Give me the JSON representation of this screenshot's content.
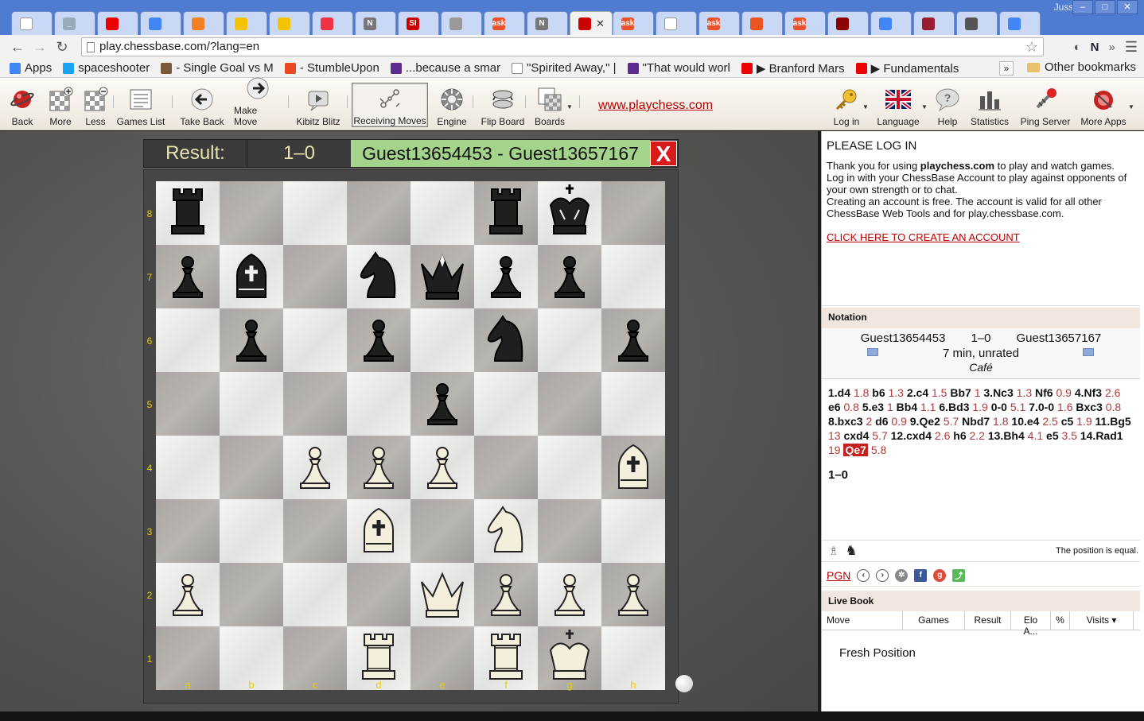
{
  "browser": {
    "user": "Jussi",
    "url": "play.chessbase.com/?lang=en",
    "tabs": [
      {
        "label": "",
        "fav": "doc-icon",
        "color": "#ffffff"
      },
      {
        "label": "_",
        "fav": "blank-icon",
        "color": "#9ab"
      },
      {
        "label": "",
        "fav": "youtube-icon",
        "color": "#e00"
      },
      {
        "label": "",
        "fav": "google-icon",
        "color": "#4285f4"
      },
      {
        "label": "",
        "fav": "stack-icon",
        "color": "#f48024"
      },
      {
        "label": "",
        "fav": "p-icon",
        "color": "#f5c400"
      },
      {
        "label": "",
        "fav": "p-icon",
        "color": "#f5c400"
      },
      {
        "label": "",
        "fav": "circle-icon",
        "color": "#e34"
      },
      {
        "label": "N",
        "fav": "n-icon",
        "color": "#777"
      },
      {
        "label": "SI",
        "fav": "si-icon",
        "color": "#c00"
      },
      {
        "label": "",
        "fav": "wand-icon",
        "color": "#999"
      },
      {
        "label": "ask",
        "fav": "ask-icon",
        "color": "#e8522c"
      },
      {
        "label": "N",
        "fav": "n-icon",
        "color": "#777"
      },
      {
        "label": "",
        "fav": "chessbase-icon",
        "color": "#c00",
        "active": true
      },
      {
        "label": "ask",
        "fav": "ask-icon",
        "color": "#e8522c"
      },
      {
        "label": "",
        "fav": "doc-icon",
        "color": "#ffffff"
      },
      {
        "label": "ask",
        "fav": "ask-icon",
        "color": "#e8522c"
      },
      {
        "label": "",
        "fav": "ubuntu-icon",
        "color": "#e95420"
      },
      {
        "label": "ask",
        "fav": "ask-icon",
        "color": "#e8522c"
      },
      {
        "label": "",
        "fav": "c-icon",
        "color": "#8b0000"
      },
      {
        "label": "",
        "fav": "google-icon",
        "color": "#4285f4"
      },
      {
        "label": "",
        "fav": "dice-icon",
        "color": "#9b1b30"
      },
      {
        "label": "",
        "fav": "u-icon",
        "color": "#555"
      },
      {
        "label": "",
        "fav": "google-icon",
        "color": "#4285f4"
      }
    ],
    "bookmarks": [
      {
        "label": "Apps",
        "color": "#4285f4"
      },
      {
        "label": "spaceshooter",
        "color": "#1da1f2"
      },
      {
        "label": "- Single Goal vs M",
        "color": "#7a5a3a"
      },
      {
        "label": "- StumbleUpon",
        "color": "#eb4924"
      },
      {
        "label": "...because a smar",
        "color": "#5b2d8e"
      },
      {
        "label": "\"Spirited Away,\" |",
        "color": "#ffffff"
      },
      {
        "label": "\"That would worl",
        "color": "#5b2d8e"
      },
      {
        "label": "▶ Branford Mars",
        "color": "#e00"
      },
      {
        "label": "▶ Fundamentals",
        "color": "#e00"
      }
    ],
    "bookmarks_overflow": "»",
    "other_bookmarks": "Other bookmarks"
  },
  "app_toolbar": {
    "buttons": [
      {
        "label": "Back",
        "icon": "planet-icon"
      },
      {
        "label": "More",
        "icon": "board-plus-icon"
      },
      {
        "label": "Less",
        "icon": "board-minus-icon"
      },
      {
        "label": "Games List",
        "icon": "list-icon"
      },
      {
        "label": "Take Back",
        "icon": "arrow-left-icon"
      },
      {
        "label": "Make Move",
        "icon": "arrow-right-icon"
      },
      {
        "label": "Kibitz Blitz",
        "icon": "kibitz-icon"
      },
      {
        "label": "Receiving Moves",
        "icon": "connection-icon",
        "pressed": true
      },
      {
        "label": "Engine",
        "icon": "engine-icon"
      },
      {
        "label": "Flip Board",
        "icon": "flip-icon"
      },
      {
        "label": "Boards",
        "icon": "boards-icon"
      }
    ],
    "link": "www.playchess.com",
    "right_buttons": [
      {
        "label": "Log in",
        "icon": "key-icon"
      },
      {
        "label": "Language",
        "icon": "uk-flag-icon"
      },
      {
        "label": "Help",
        "icon": "help-icon"
      },
      {
        "label": "Statistics",
        "icon": "statistics-icon"
      },
      {
        "label": "Ping Server",
        "icon": "ping-icon"
      },
      {
        "label": "More Apps",
        "icon": "apps-icon"
      }
    ]
  },
  "result_bar": {
    "label": "Result:",
    "score": "1–0",
    "players": "Guest13654453 - Guest13657167",
    "close": "X"
  },
  "board": {
    "ranks": [
      "8",
      "7",
      "6",
      "5",
      "4",
      "3",
      "2",
      "1"
    ],
    "files": [
      "a",
      "b",
      "c",
      "d",
      "e",
      "f",
      "g",
      "h"
    ],
    "pieces": [
      {
        "sq": "a8",
        "type": "r",
        "color": "b"
      },
      {
        "sq": "f8",
        "type": "r",
        "color": "b"
      },
      {
        "sq": "g8",
        "type": "k",
        "color": "b"
      },
      {
        "sq": "a7",
        "type": "p",
        "color": "b"
      },
      {
        "sq": "b7",
        "type": "b",
        "color": "b"
      },
      {
        "sq": "d7",
        "type": "n",
        "color": "b"
      },
      {
        "sq": "e7",
        "type": "q",
        "color": "b"
      },
      {
        "sq": "f7",
        "type": "p",
        "color": "b"
      },
      {
        "sq": "g7",
        "type": "p",
        "color": "b"
      },
      {
        "sq": "b6",
        "type": "p",
        "color": "b"
      },
      {
        "sq": "d6",
        "type": "p",
        "color": "b"
      },
      {
        "sq": "f6",
        "type": "n",
        "color": "b"
      },
      {
        "sq": "h6",
        "type": "p",
        "color": "b"
      },
      {
        "sq": "e5",
        "type": "p",
        "color": "b"
      },
      {
        "sq": "c4",
        "type": "p",
        "color": "w"
      },
      {
        "sq": "d4",
        "type": "p",
        "color": "w"
      },
      {
        "sq": "e4",
        "type": "p",
        "color": "w"
      },
      {
        "sq": "h4",
        "type": "b",
        "color": "w"
      },
      {
        "sq": "d3",
        "type": "b",
        "color": "w"
      },
      {
        "sq": "f3",
        "type": "n",
        "color": "w"
      },
      {
        "sq": "a2",
        "type": "p",
        "color": "w"
      },
      {
        "sq": "e2",
        "type": "q",
        "color": "w"
      },
      {
        "sq": "f2",
        "type": "p",
        "color": "w"
      },
      {
        "sq": "g2",
        "type": "p",
        "color": "w"
      },
      {
        "sq": "h2",
        "type": "p",
        "color": "w"
      },
      {
        "sq": "d1",
        "type": "r",
        "color": "w"
      },
      {
        "sq": "f1",
        "type": "r",
        "color": "w"
      },
      {
        "sq": "g1",
        "type": "k",
        "color": "w"
      }
    ]
  },
  "login": {
    "title": "PLEASE LOG IN",
    "line1_pre": "Thank you for using ",
    "line1_bold": "playchess.com",
    "line1_post": " to play and watch games.",
    "line2": "Log in with your ChessBase Account to play against opponents of your own strength or to chat.",
    "line3": "Creating an account is free. The account is valid for all other ChessBase Web Tools and for play.chessbase.com.",
    "create_link": "CLICK HERE TO CREATE AN ACCOUNT"
  },
  "notation": {
    "header": "Notation",
    "white": "Guest13654453",
    "result": "1–0",
    "black": "Guest13657167",
    "time_control": "7 min, unrated",
    "event": "Café",
    "moves": [
      {
        "m": "1.d4",
        "t": "1.8"
      },
      {
        "m": "b6",
        "t": "1.3"
      },
      {
        "m": "2.c4",
        "t": "1.5"
      },
      {
        "m": "Bb7",
        "t": "1"
      },
      {
        "m": "3.Nc3",
        "t": "1.3"
      },
      {
        "m": "Nf6",
        "t": "0.9"
      },
      {
        "m": "4.Nf3",
        "t": "2.6"
      },
      {
        "m": "e6",
        "t": "0.8"
      },
      {
        "m": "5.e3",
        "t": "1"
      },
      {
        "m": "Bb4",
        "t": "1.1"
      },
      {
        "m": "6.Bd3",
        "t": "1.9"
      },
      {
        "m": "0-0",
        "t": "5.1"
      },
      {
        "m": "7.0-0",
        "t": "1.6"
      },
      {
        "m": "Bxc3",
        "t": "0.8"
      },
      {
        "m": "8.bxc3",
        "t": "2"
      },
      {
        "m": "d6",
        "t": "0.9"
      },
      {
        "m": "9.Qe2",
        "t": "5.7"
      },
      {
        "m": "Nbd7",
        "t": "1.8"
      },
      {
        "m": "10.e4",
        "t": "2.5"
      },
      {
        "m": "c5",
        "t": "1.9"
      },
      {
        "m": "11.Bg5",
        "t": "13"
      },
      {
        "m": "cxd4",
        "t": "5.7"
      },
      {
        "m": "12.cxd4",
        "t": "2.6"
      },
      {
        "m": "h6",
        "t": "2.2"
      },
      {
        "m": "13.Bh4",
        "t": "4.1"
      },
      {
        "m": "e5",
        "t": "3.5"
      },
      {
        "m": "14.Rad1",
        "t": "19"
      },
      {
        "m": "Qe7",
        "t": "5.8",
        "current": true
      }
    ],
    "final_result": "1–0",
    "eval_text": "The position is equal.",
    "pgn_label": "PGN"
  },
  "live_book": {
    "header": "Live Book",
    "columns": [
      "Move",
      "Games",
      "Result",
      "Elo A...",
      "%",
      "Visits ▾"
    ],
    "empty_text": "Fresh Position"
  }
}
